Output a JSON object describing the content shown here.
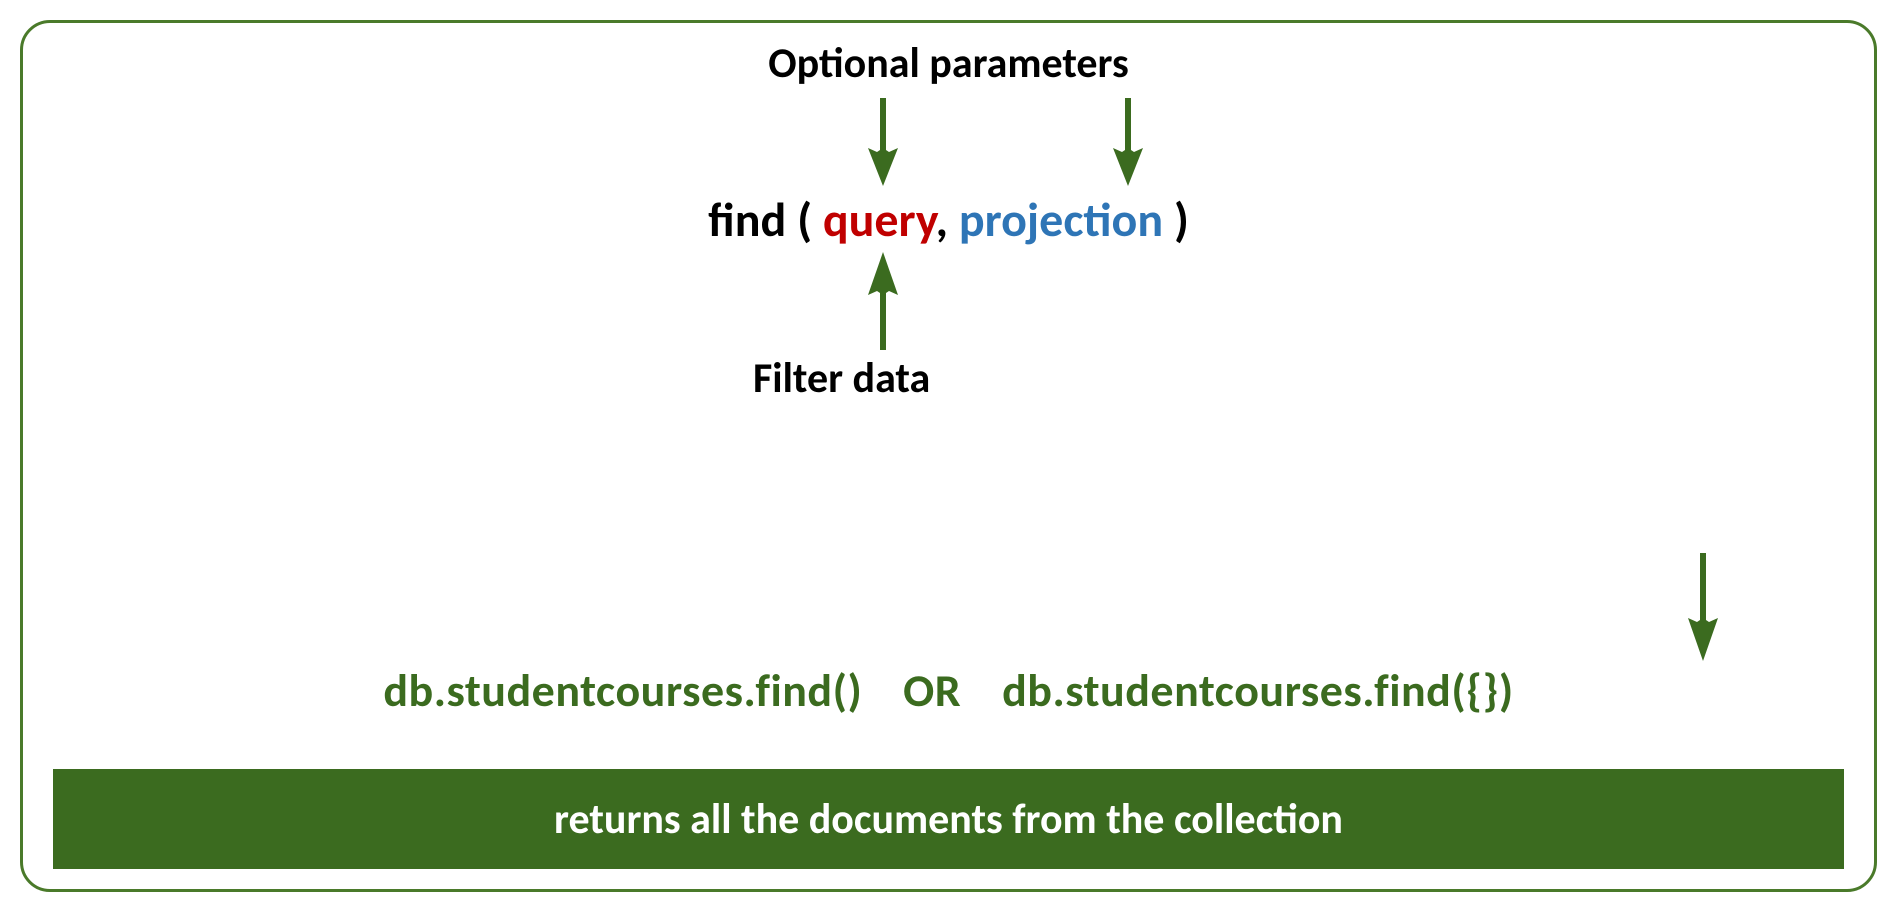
{
  "labels": {
    "optional": "Optional parameters",
    "filter": "Filter data"
  },
  "find": {
    "func": "find",
    "open": " ( ",
    "query": "query",
    "comma": ", ",
    "projection": "projection",
    "close": " )"
  },
  "code": {
    "left": "db.studentcourses.find()",
    "or": "OR",
    "right": "db.studentcourses.find({})"
  },
  "result": "returns all the documents from the collection",
  "colors": {
    "green": "#3b6b1f",
    "red": "#c00000",
    "blue": "#2e75b6",
    "border": "#4a7a2a"
  }
}
